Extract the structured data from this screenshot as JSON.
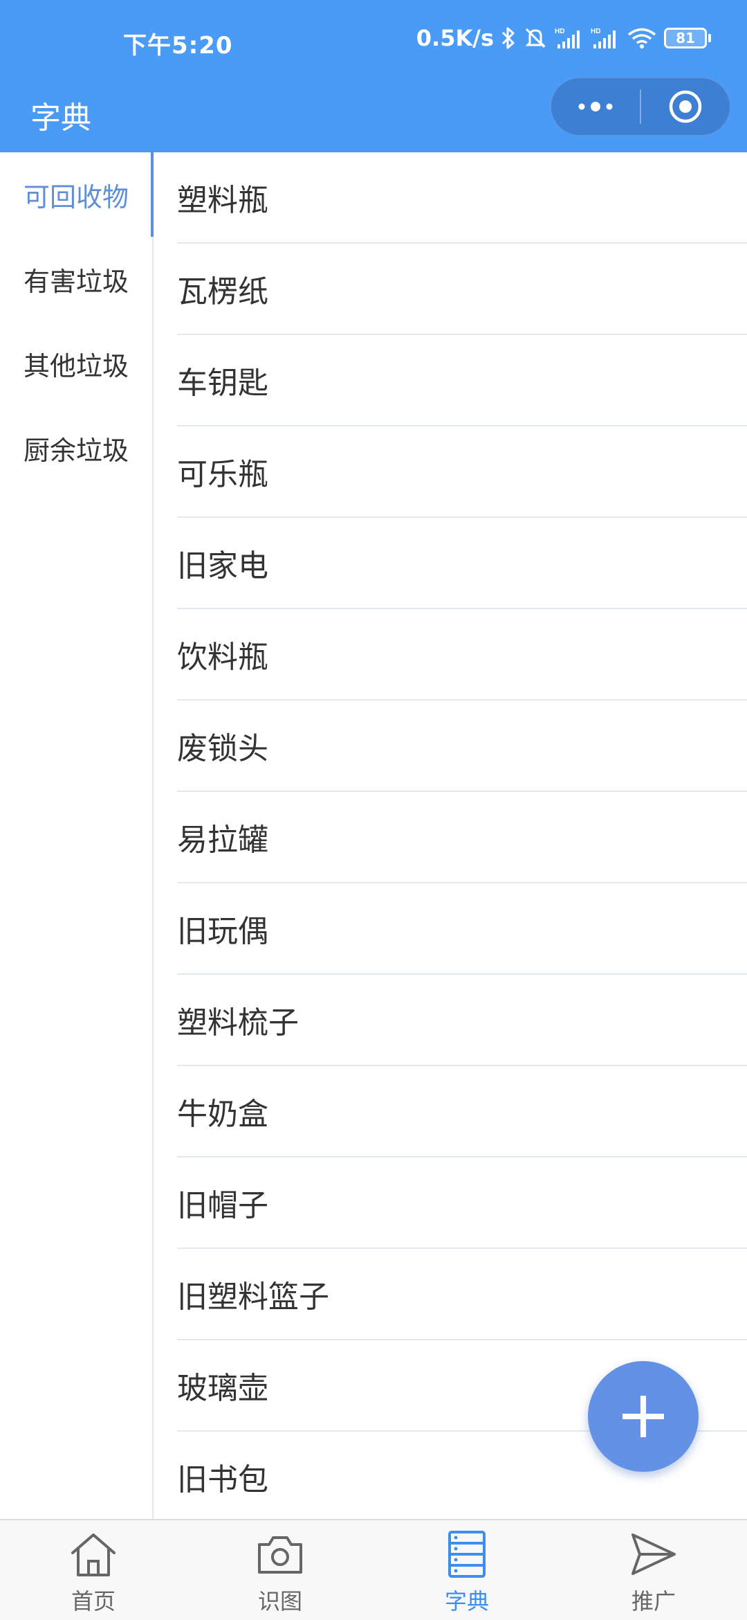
{
  "status_bar": {
    "time": "下午5:20",
    "network_speed": "0.5K/s",
    "battery": "81"
  },
  "header": {
    "title": "字典"
  },
  "sidebar": {
    "items": [
      {
        "label": "可回收物",
        "active": true
      },
      {
        "label": "有害垃圾",
        "active": false
      },
      {
        "label": "其他垃圾",
        "active": false
      },
      {
        "label": "厨余垃圾",
        "active": false
      }
    ]
  },
  "list": {
    "items": [
      "塑料瓶",
      "瓦楞纸",
      "车钥匙",
      "可乐瓶",
      "旧家电",
      "饮料瓶",
      "废锁头",
      "易拉罐",
      "旧玩偶",
      "塑料梳子",
      "牛奶盒",
      "旧帽子",
      "旧塑料篮子",
      "玻璃壶",
      "旧书包"
    ]
  },
  "tab_bar": {
    "tabs": [
      {
        "label": "首页",
        "icon": "home-icon",
        "active": false
      },
      {
        "label": "识图",
        "icon": "camera-icon",
        "active": false
      },
      {
        "label": "字典",
        "icon": "dictionary-icon",
        "active": true
      },
      {
        "label": "推广",
        "icon": "send-icon",
        "active": false
      }
    ]
  },
  "colors": {
    "header_bg": "#4a9bf5",
    "active_side": "#5f8fd8",
    "fab": "#6391e6",
    "active_tab": "#3d8ef0"
  }
}
